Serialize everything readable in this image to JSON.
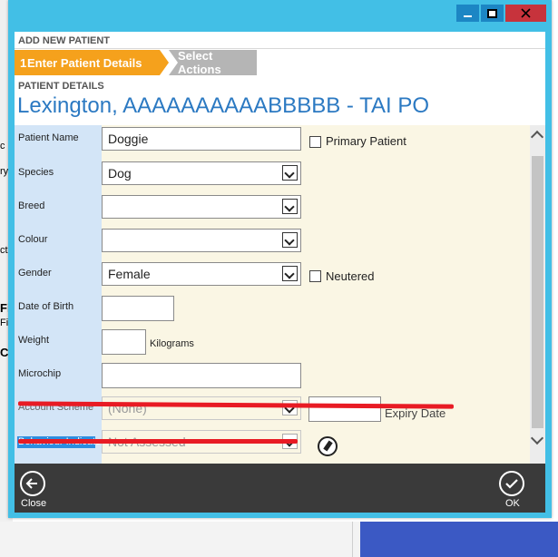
{
  "window": {
    "title": "ADD NEW PATIENT",
    "controls": {
      "minimize_icon": "minimize-icon",
      "maximize_icon": "maximize-icon",
      "close_icon": "close-icon"
    },
    "colors": {
      "frame": "#42bfe6",
      "close": "#c7333c",
      "accent": "#f5a11c",
      "title_text": "#2b79c2"
    }
  },
  "background": {
    "fragments": [
      "c",
      "ry",
      "cti",
      "Fi",
      "Fie",
      "Co"
    ]
  },
  "steps": [
    {
      "number": "1",
      "label": "Enter Patient Details",
      "active": true
    },
    {
      "label": "Select Actions",
      "active": false
    }
  ],
  "section": {
    "title": "PATIENT DETAILS"
  },
  "patient_header": "Lexington, AAAAAAAAAABBBBB - TAI PO",
  "form": {
    "patient_name": {
      "label": "Patient Name",
      "value": "Doggie"
    },
    "primary_patient": {
      "label": "Primary Patient",
      "checked": false
    },
    "species": {
      "label": "Species",
      "value": "Dog"
    },
    "breed": {
      "label": "Breed",
      "value": ""
    },
    "colour": {
      "label": "Colour",
      "value": ""
    },
    "gender": {
      "label": "Gender",
      "value": "Female"
    },
    "neutered": {
      "label": "Neutered",
      "checked": false
    },
    "date_of_birth": {
      "label": "Date of Birth",
      "value": ""
    },
    "weight": {
      "label": "Weight",
      "value": "",
      "unit": "Kilograms"
    },
    "microchip": {
      "label": "Microchip",
      "value": ""
    },
    "account_scheme": {
      "label": "Account Scheme",
      "value": "(None)"
    },
    "expiry_date": {
      "label": "Expiry Date",
      "value": ""
    },
    "behaviour": {
      "label": "Behaviour Indicator",
      "value": "Not Assessed"
    }
  },
  "footer": {
    "close": {
      "label": "Close",
      "icon": "arrow-left-icon"
    },
    "ok": {
      "label": "OK",
      "icon": "checkmark-icon"
    }
  }
}
